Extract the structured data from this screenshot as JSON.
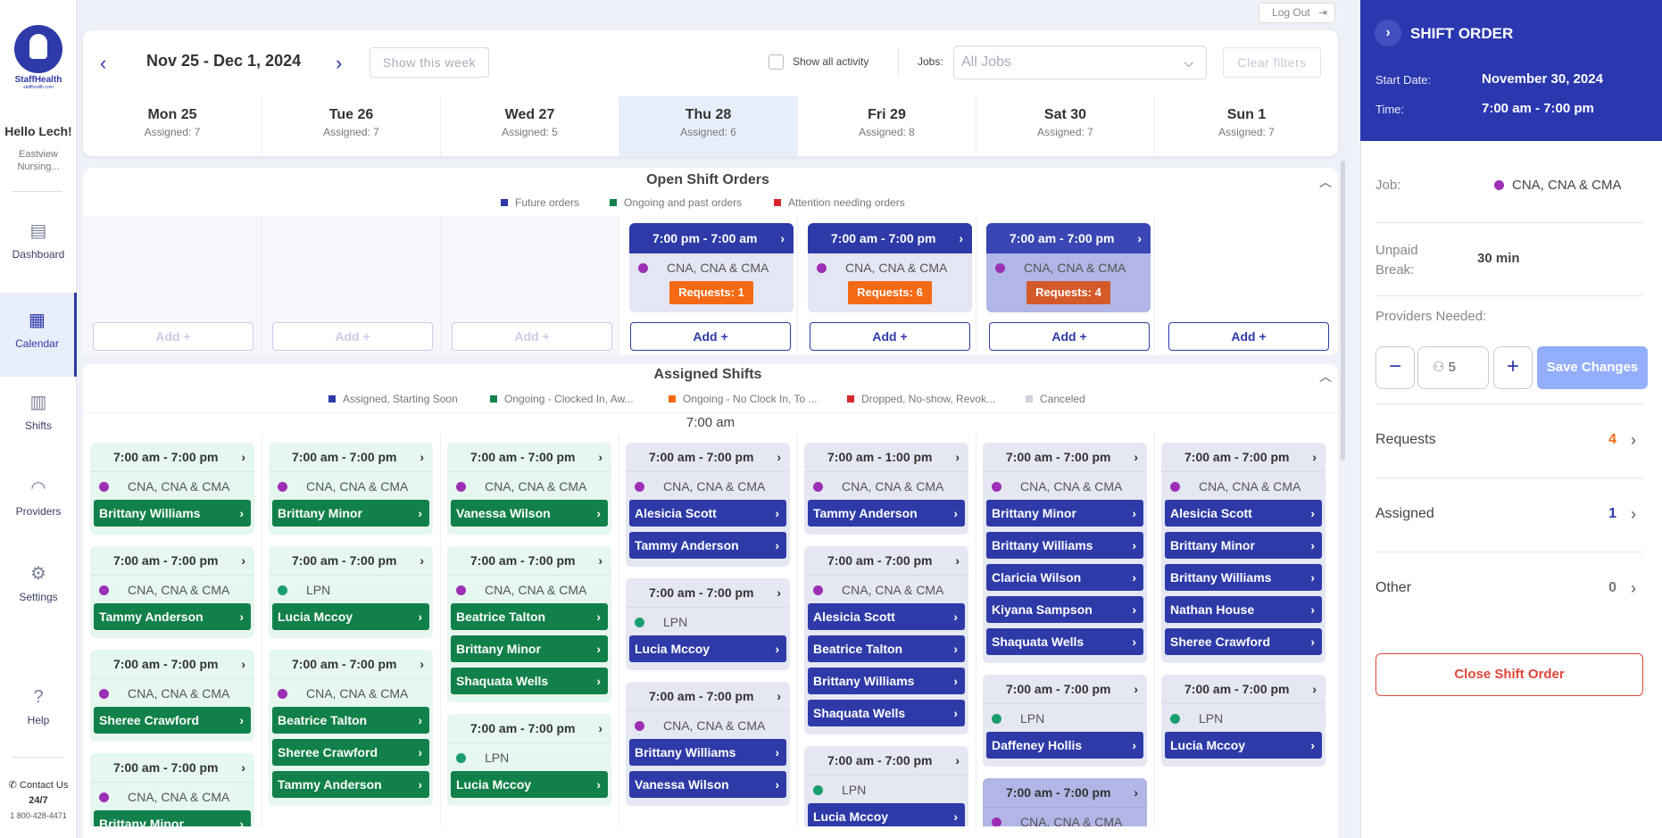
{
  "nav": {
    "logo_text": "StaffHealth",
    "logo_sub": "staffhealth.com",
    "greeting": "Hello Lech!",
    "facility": "Eastview Nursing...",
    "items": [
      {
        "label": "Dashboard",
        "icon": "dashboard-icon"
      },
      {
        "label": "Calendar",
        "icon": "calendar-icon"
      },
      {
        "label": "Shifts",
        "icon": "shifts-icon"
      },
      {
        "label": "Providers",
        "icon": "providers-icon"
      },
      {
        "label": "Settings",
        "icon": "settings-icon"
      },
      {
        "label": "Help",
        "icon": "help-icon"
      }
    ],
    "contact": "Contact Us",
    "contact_hours": "24/7",
    "phone": "1 800-428-4471"
  },
  "header": {
    "logout": "Log Out",
    "week_range": "Nov 25 - Dec 1, 2024",
    "show_this_week": "Show this week",
    "show_all_activity": "Show all activity",
    "jobs_label": "Jobs:",
    "jobs_placeholder": "All Jobs",
    "clear_filters": "Clear filters"
  },
  "days": [
    {
      "name": "Mon 25",
      "assigned": "Assigned: 7"
    },
    {
      "name": "Tue 26",
      "assigned": "Assigned: 7"
    },
    {
      "name": "Wed 27",
      "assigned": "Assigned: 5"
    },
    {
      "name": "Thu 28",
      "assigned": "Assigned: 6"
    },
    {
      "name": "Fri 29",
      "assigned": "Assigned: 8"
    },
    {
      "name": "Sat 30",
      "assigned": "Assigned: 7"
    },
    {
      "name": "Sun 1",
      "assigned": "Assigned: 7"
    }
  ],
  "open_orders": {
    "title": "Open Shift Orders",
    "legend": [
      "Future orders",
      "Ongoing and past orders",
      "Attention needing orders"
    ],
    "add_label": "Add",
    "cards": [
      {
        "time": "7:00 pm - 7:00 am",
        "job": "CNA, CNA & CMA",
        "requests": "Requests: 1"
      },
      {
        "time": "7:00 am - 7:00 pm",
        "job": "CNA, CNA & CMA",
        "requests": "Requests: 6"
      },
      {
        "time": "7:00 am - 7:00 pm",
        "job": "CNA, CNA & CMA",
        "requests": "Requests: 4"
      }
    ]
  },
  "assigned": {
    "title": "Assigned Shifts",
    "legend": [
      "Assigned, Starting Soon",
      "Ongoing - Clocked In, Aw...",
      "Ongoing - No Clock In, To ...",
      "Dropped, No-show, Revok...",
      "Canceled"
    ],
    "time_marker": "7:00 am",
    "columns": [
      [
        {
          "time": "7:00 am - 7:00 pm",
          "job": "CNA, CNA & CMA",
          "people": [
            "Brittany Williams"
          ]
        },
        {
          "time": "7:00 am - 7:00 pm",
          "job": "CNA, CNA & CMA",
          "people": [
            "Tammy Anderson"
          ]
        },
        {
          "time": "7:00 am - 7:00 pm",
          "job": "CNA, CNA & CMA",
          "people": [
            "Sheree Crawford"
          ]
        },
        {
          "time": "7:00 am - 7:00 pm",
          "job": "CNA, CNA & CMA",
          "people": [
            "Brittany Minor"
          ]
        }
      ],
      [
        {
          "time": "7:00 am - 7:00 pm",
          "job": "CNA, CNA & CMA",
          "people": [
            "Brittany Minor"
          ]
        },
        {
          "time": "7:00 am - 7:00 pm",
          "job": "LPN",
          "people": [
            "Lucia Mccoy"
          ]
        },
        {
          "time": "7:00 am - 7:00 pm",
          "job": "CNA, CNA & CMA",
          "people": [
            "Beatrice Talton",
            "Sheree Crawford",
            "Tammy Anderson"
          ]
        }
      ],
      [
        {
          "time": "7:00 am - 7:00 pm",
          "job": "CNA, CNA & CMA",
          "people": [
            "Vanessa Wilson"
          ]
        },
        {
          "time": "7:00 am - 7:00 pm",
          "job": "CNA, CNA & CMA",
          "people": [
            "Beatrice Talton",
            "Brittany Minor",
            "Shaquata Wells"
          ]
        },
        {
          "time": "7:00 am - 7:00 pm",
          "job": "LPN",
          "people": [
            "Lucia Mccoy"
          ]
        }
      ],
      [
        {
          "time": "7:00 am - 7:00 pm",
          "job": "CNA, CNA & CMA",
          "people": [
            "Alesicia Scott",
            "Tammy Anderson"
          ]
        },
        {
          "time": "7:00 am - 7:00 pm",
          "job": "LPN",
          "people": [
            "Lucia Mccoy"
          ]
        },
        {
          "time": "7:00 am - 7:00 pm",
          "job": "CNA, CNA & CMA",
          "people": [
            "Brittany Williams",
            "Vanessa Wilson"
          ]
        }
      ],
      [
        {
          "time": "7:00 am - 1:00 pm",
          "job": "CNA, CNA & CMA",
          "people": [
            "Tammy Anderson"
          ]
        },
        {
          "time": "7:00 am - 7:00 pm",
          "job": "CNA, CNA & CMA",
          "people": [
            "Alesicia Scott",
            "Beatrice Talton",
            "Brittany Williams",
            "Shaquata Wells"
          ]
        },
        {
          "time": "7:00 am - 7:00 pm",
          "job": "LPN",
          "people": [
            "Lucia Mccoy"
          ]
        }
      ],
      [
        {
          "time": "7:00 am - 7:00 pm",
          "job": "CNA, CNA & CMA",
          "people": [
            "Brittany Minor",
            "Brittany Williams",
            "Claricia Wilson",
            "Kiyana Sampson",
            "Shaquata Wells"
          ]
        },
        {
          "time": "7:00 am - 7:00 pm",
          "job": "LPN",
          "people": [
            "Daffeney Hollis"
          ]
        },
        {
          "time": "7:00 am - 7:00 pm",
          "job": "CNA, CNA & CMA",
          "people": []
        }
      ],
      [
        {
          "time": "7:00 am - 7:00 pm",
          "job": "CNA, CNA & CMA",
          "people": [
            "Alesicia Scott",
            "Brittany Minor",
            "Brittany Williams",
            "Nathan House",
            "Sheree Crawford"
          ]
        },
        {
          "time": "7:00 am - 7:00 pm",
          "job": "LPN",
          "people": [
            "Lucia Mccoy"
          ]
        }
      ]
    ]
  },
  "shift_order": {
    "title": "SHIFT ORDER",
    "start_date_label": "Start Date:",
    "start_date": "November 30, 2024",
    "time_label": "Time:",
    "time": "7:00 am - 7:00 pm",
    "job_label": "Job:",
    "job": "CNA, CNA & CMA",
    "unpaid_break_label": "Unpaid Break:",
    "unpaid_break": "30 min",
    "providers_needed_label": "Providers Needed:",
    "providers_needed": "5",
    "save": "Save Changes",
    "requests_label": "Requests",
    "requests_count": "4",
    "assigned_label": "Assigned",
    "assigned_count": "1",
    "other_label": "Other",
    "other_count": "0",
    "close": "Close Shift Order"
  },
  "colors": {
    "primary": "#2e3aa8",
    "green": "#11804a",
    "orange": "#f56a14",
    "red": "#e0453a",
    "job_cna_dot": "#9c2fb5",
    "job_lpn_dot": "#1a9e6e"
  }
}
